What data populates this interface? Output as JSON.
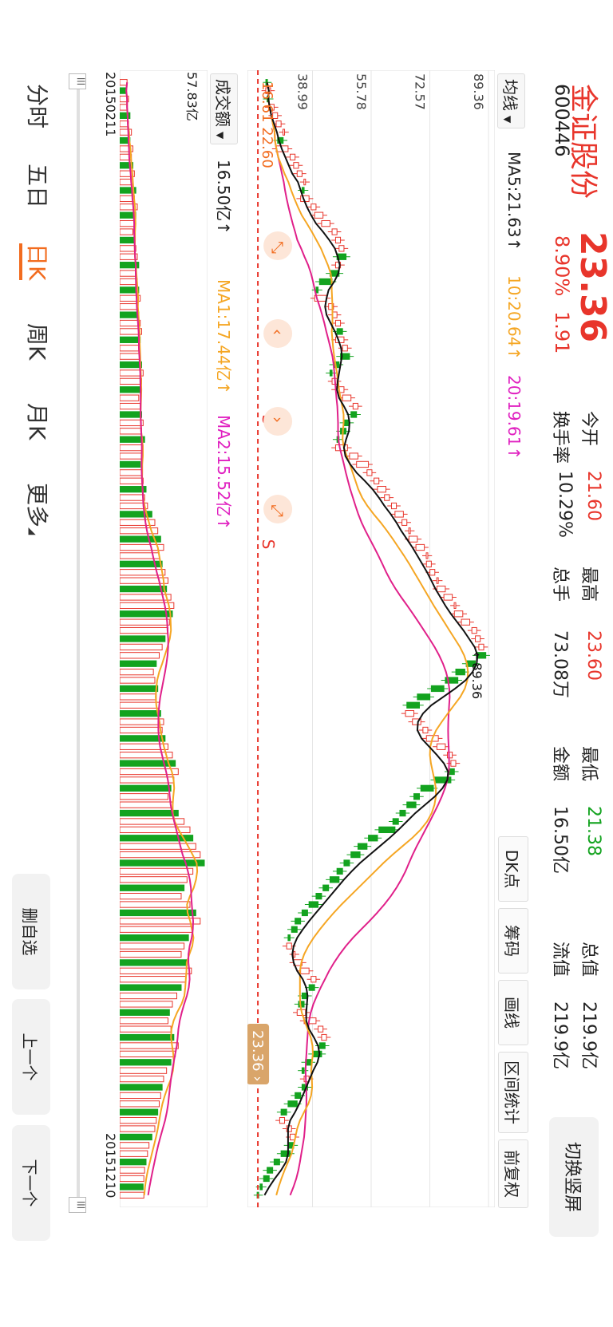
{
  "header": {
    "name": "金证股份",
    "price": "23.36",
    "code": "600446",
    "change_pct": "8.90%",
    "change_abs": "1.91",
    "open_label": "今开",
    "open_value": "21.60",
    "high_label": "最高",
    "high_value": "23.60",
    "low_label": "最低",
    "low_value": "21.38",
    "total_mv_label": "总值",
    "total_mv_value": "219.9亿",
    "turnover_label": "换手率",
    "turnover_value": "10.29%",
    "volume_label": "总手",
    "volume_value": "73.08万",
    "amount_label": "金额",
    "amount_value": "16.50亿",
    "float_mv_label": "流值",
    "float_mv_value": "219.9亿",
    "switch_button": "切换竖屏"
  },
  "toolbar": {
    "ma_select": "均线",
    "ma5": "MA5:21.63↑",
    "ma10": "10:20.64↑",
    "ma20": "20:19.61↑",
    "buttons": [
      "DK点",
      "筹码",
      "画线",
      "区间统计",
      "前复权"
    ]
  },
  "chart_controls": {
    "vol_select": "成交额",
    "vol_value": "16.50亿↑",
    "vol_ma1": "MA1:17.44亿↑",
    "vol_ma2": "MA2:15.52亿↑",
    "last_price_tag": "23.36",
    "cut_label": "16.61 22.60",
    "max_label": "←89.36",
    "start_date": "20150211",
    "end_date": "20151210",
    "vol_axis_top": "57.83亿",
    "s_marks": [
      "S",
      "S"
    ],
    "gesture_icons": [
      "zoom-in-icon",
      "scroll-left-icon",
      "scroll-right-icon",
      "zoom-out-icon"
    ]
  },
  "nav": {
    "tabs": [
      "分时",
      "五日",
      "日K",
      "周K",
      "月K",
      "更多"
    ],
    "active": "日K",
    "actions": [
      "删自选",
      "上一个",
      "下一个"
    ]
  },
  "colors": {
    "up": "#e8352b",
    "down": "#13a31f",
    "ma5": "#111111",
    "ma10": "#f5a623",
    "ma20": "#e0208a",
    "accent": "#f26c1f"
  },
  "chart_data": {
    "type": "candlestick",
    "title": "",
    "ylim": [
      22.2,
      89.36
    ],
    "yticks": [
      "89.36",
      "72.57",
      "55.78",
      "38.99"
    ],
    "date_range": [
      "20150211",
      "20151210"
    ],
    "closes": [
      26,
      27,
      26,
      28,
      29,
      30,
      31,
      29,
      32,
      34,
      35,
      36,
      37,
      36,
      38,
      40,
      42,
      44,
      46,
      47,
      48,
      46,
      47,
      44,
      41,
      40,
      43,
      45,
      46,
      47,
      46,
      48,
      49,
      47,
      45,
      44,
      46,
      48,
      50,
      52,
      50,
      48,
      47,
      46,
      49,
      52,
      55,
      56,
      58,
      60,
      61,
      63,
      65,
      66,
      67,
      69,
      71,
      72,
      73,
      74,
      75,
      77,
      79,
      80,
      82,
      84,
      86,
      87,
      88,
      86,
      83,
      80,
      77,
      73,
      69,
      66,
      68,
      70,
      72,
      75,
      77,
      79,
      80,
      78,
      74,
      70,
      68,
      66,
      64,
      62,
      58,
      55,
      52,
      50,
      48,
      46,
      44,
      42,
      40,
      38,
      36,
      34,
      33,
      32,
      33,
      34,
      36,
      38,
      40,
      38,
      36,
      35,
      37,
      40,
      42,
      43,
      41,
      39,
      37,
      36,
      38,
      36,
      34,
      32,
      30,
      31,
      33,
      34,
      32,
      30,
      28,
      26,
      25,
      24,
      23.36
    ],
    "volumes": [
      5,
      4,
      6,
      5,
      7,
      6,
      8,
      7,
      9,
      8,
      9,
      10,
      9,
      11,
      10,
      12,
      11,
      10,
      9,
      10,
      11,
      12,
      13,
      11,
      12,
      13,
      14,
      12,
      13,
      14,
      15,
      14,
      13,
      14,
      15,
      16,
      15,
      14,
      13,
      14,
      15,
      16,
      15,
      17,
      16,
      15,
      14,
      15,
      16,
      18,
      17,
      19,
      22,
      24,
      26,
      28,
      30,
      27,
      29,
      31,
      33,
      32,
      35,
      37,
      36,
      34,
      33,
      31,
      29,
      27,
      25,
      23,
      24,
      26,
      25,
      27,
      28,
      30,
      29,
      31,
      33,
      36,
      38,
      40,
      37,
      35,
      33,
      36,
      40,
      44,
      48,
      50,
      52,
      55,
      57.83,
      50,
      46,
      44,
      42,
      48,
      52,
      55,
      50,
      47,
      44,
      42,
      46,
      49,
      45,
      42,
      39,
      36,
      34,
      33,
      35,
      37,
      40,
      38,
      35,
      32,
      30,
      29,
      28,
      27,
      26,
      25,
      24,
      22,
      20,
      19,
      18,
      17,
      16.5,
      16,
      16.5
    ],
    "ma5": [],
    "ma10": [],
    "ma20": []
  }
}
